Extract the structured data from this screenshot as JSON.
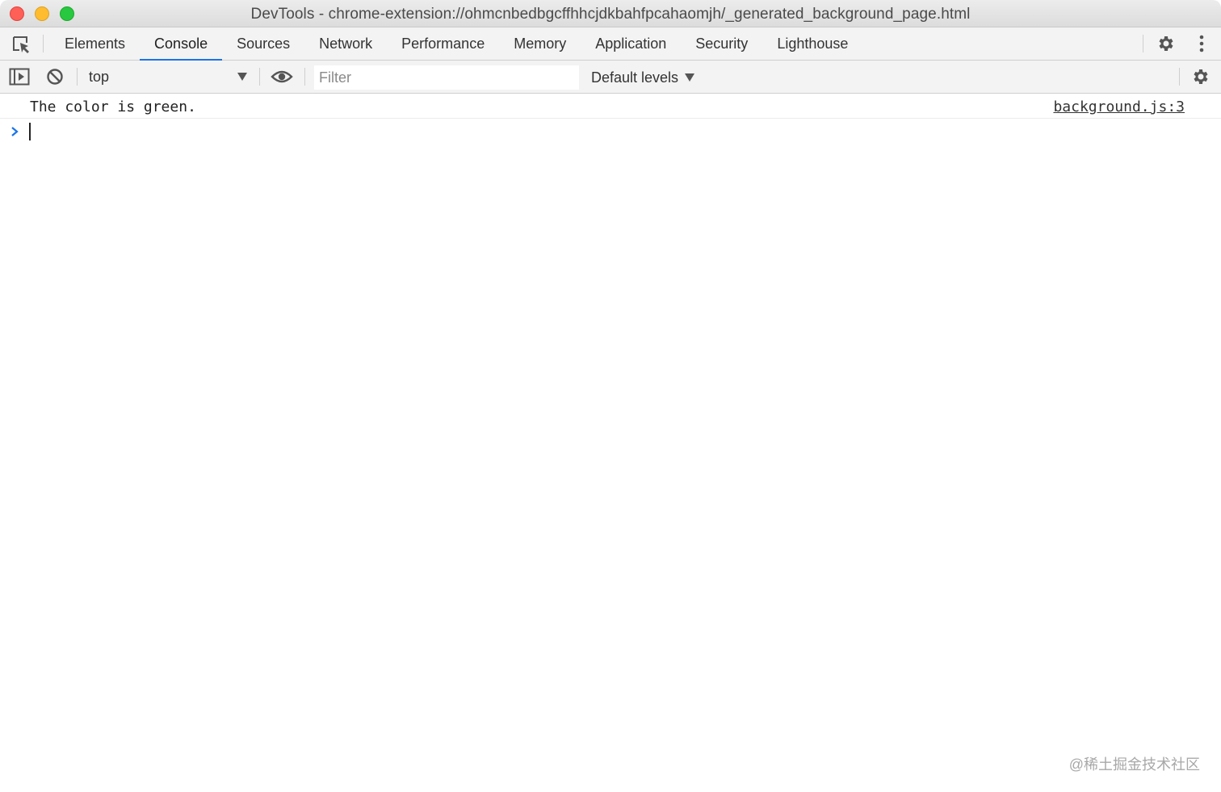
{
  "window": {
    "title": "DevTools - chrome-extension://ohmcnbedbgcffhhcjdkbahfpcahaomjh/_generated_background_page.html"
  },
  "tabs": [
    {
      "label": "Elements"
    },
    {
      "label": "Console",
      "active": true
    },
    {
      "label": "Sources"
    },
    {
      "label": "Network"
    },
    {
      "label": "Performance"
    },
    {
      "label": "Memory"
    },
    {
      "label": "Application"
    },
    {
      "label": "Security"
    },
    {
      "label": "Lighthouse"
    }
  ],
  "toolbar": {
    "context": "top",
    "filter_placeholder": "Filter",
    "filter_value": "",
    "levels": "Default levels"
  },
  "console": {
    "messages": [
      {
        "text": "The color is green.",
        "source": "background.js:3"
      }
    ],
    "input_value": ""
  },
  "watermark": "@稀土掘金技术社区",
  "colors": {
    "accent": "#1a73e8",
    "prompt": "#1a73e8",
    "close": "#fe5f57",
    "minimize": "#febc2e",
    "maximize": "#28c840"
  },
  "icons": [
    "inspect-element-icon",
    "gear-icon",
    "more-vertical-icon",
    "sidebar-toggle-icon",
    "clear-console-icon",
    "dropdown-arrow-icon",
    "eye-icon",
    "prompt-chevron-icon"
  ]
}
